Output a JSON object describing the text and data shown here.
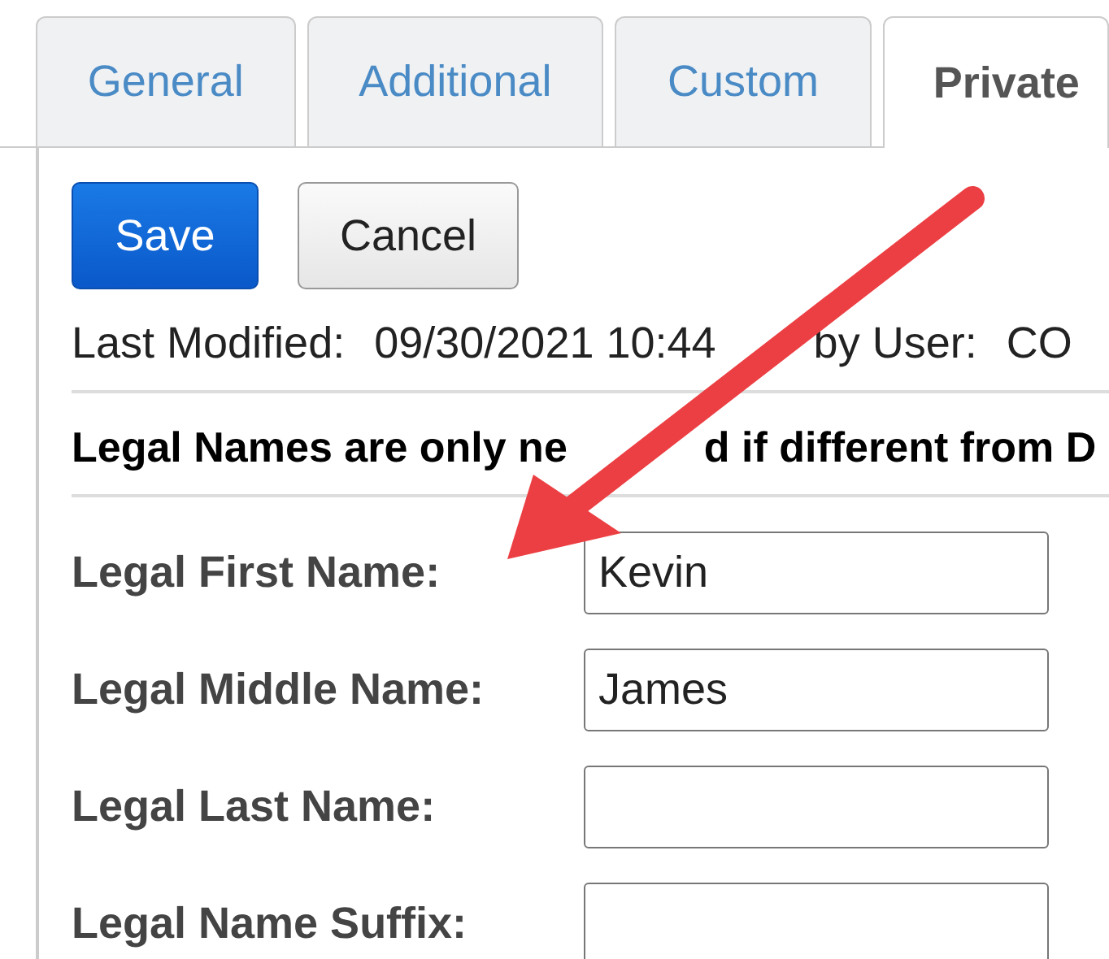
{
  "tabs": [
    {
      "label": "General",
      "selected": false
    },
    {
      "label": "Additional",
      "selected": false
    },
    {
      "label": "Custom",
      "selected": false
    },
    {
      "label": "Private",
      "selected": true
    }
  ],
  "buttons": [
    {
      "label": "Save",
      "kind": "primary"
    },
    {
      "label": "Cancel",
      "kind": "secondary"
    }
  ],
  "last_modified": {
    "label": "Last Modified:",
    "date": "09/30/2021 10:44",
    "user_label": "by User:",
    "user": "CO"
  },
  "note": [
    "Legal Names are only ne",
    "d if different from D"
  ],
  "fields": [
    {
      "label": "Legal First Name:",
      "value": "Kevin"
    },
    {
      "label": "Legal Middle Name:",
      "value": "James"
    },
    {
      "label": "Legal Last Name:"
    },
    {
      "label": "Legal Name Suffix:"
    }
  ]
}
